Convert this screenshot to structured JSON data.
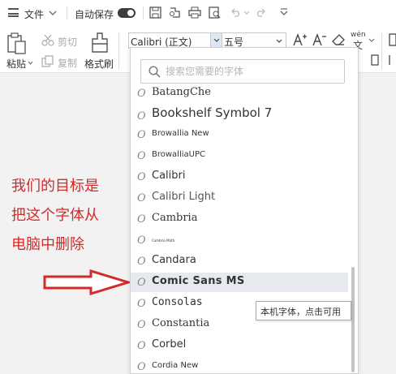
{
  "toolbar": {
    "file_menu": "文件",
    "autosave": "自动保存",
    "paste": "粘贴",
    "cut": "剪切",
    "copy": "复制",
    "format_painter": "格式刷",
    "font_value": "Calibri (正文)",
    "size_value": "五号",
    "phonetic_top": "wén",
    "phonetic_bottom": "文"
  },
  "font_dropdown": {
    "search_placeholder": "搜索您需要的字体",
    "fonts": [
      {
        "name": "BatangChe",
        "highlighted": false
      },
      {
        "name": "Bookshelf Symbol 7",
        "highlighted": false
      },
      {
        "name": "Browallia New",
        "highlighted": false
      },
      {
        "name": "BrowalliaUPC",
        "highlighted": false
      },
      {
        "name": "Calibri",
        "highlighted": false
      },
      {
        "name": "Calibri Light",
        "highlighted": false
      },
      {
        "name": "Cambria",
        "highlighted": false
      },
      {
        "name": "Cambria Math",
        "highlighted": false
      },
      {
        "name": "Candara",
        "highlighted": false
      },
      {
        "name": "Comic Sans MS",
        "highlighted": true
      },
      {
        "name": "Consolas",
        "highlighted": false
      },
      {
        "name": "Constantia",
        "highlighted": false
      },
      {
        "name": "Corbel",
        "highlighted": false
      },
      {
        "name": "Cordia New",
        "highlighted": false
      }
    ],
    "tooltip": "本机字体，点击可用"
  },
  "annotation": {
    "lines": [
      "我们的目标是",
      "把这个字体从",
      "电脑中删除"
    ],
    "color": "#d42a2a"
  }
}
